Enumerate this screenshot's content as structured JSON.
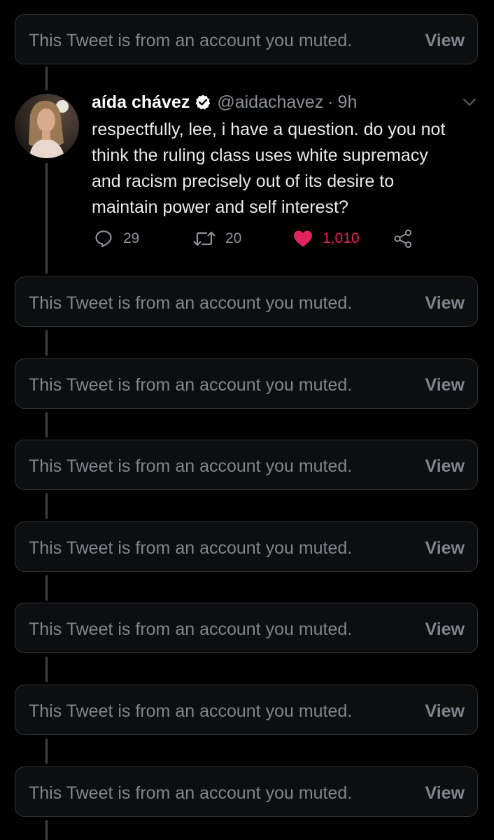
{
  "muted_notice": {
    "text": "This Tweet is from an account you muted.",
    "view_label": "View"
  },
  "tweet": {
    "display_name": "aída chávez",
    "verified": true,
    "handle": "@aidachavez",
    "separator": "·",
    "time": "9h",
    "text": "respectfully, lee, i have a question. do you not\nthink the ruling class uses white supremacy\nand racism precisely out of its desire to\nmaintain power and self interest?",
    "replies": "29",
    "retweets": "20",
    "likes": "1,010",
    "liked": true
  },
  "colors": {
    "background": "#000000",
    "card_border": "#2f3336",
    "muted_text": "#7f858c",
    "like": "#e0245e",
    "secondary_text": "#8b9299"
  },
  "icons": [
    "reply-icon",
    "retweet-icon",
    "heart-icon",
    "share-icon",
    "verified-badge-icon",
    "chevron-down-icon"
  ]
}
